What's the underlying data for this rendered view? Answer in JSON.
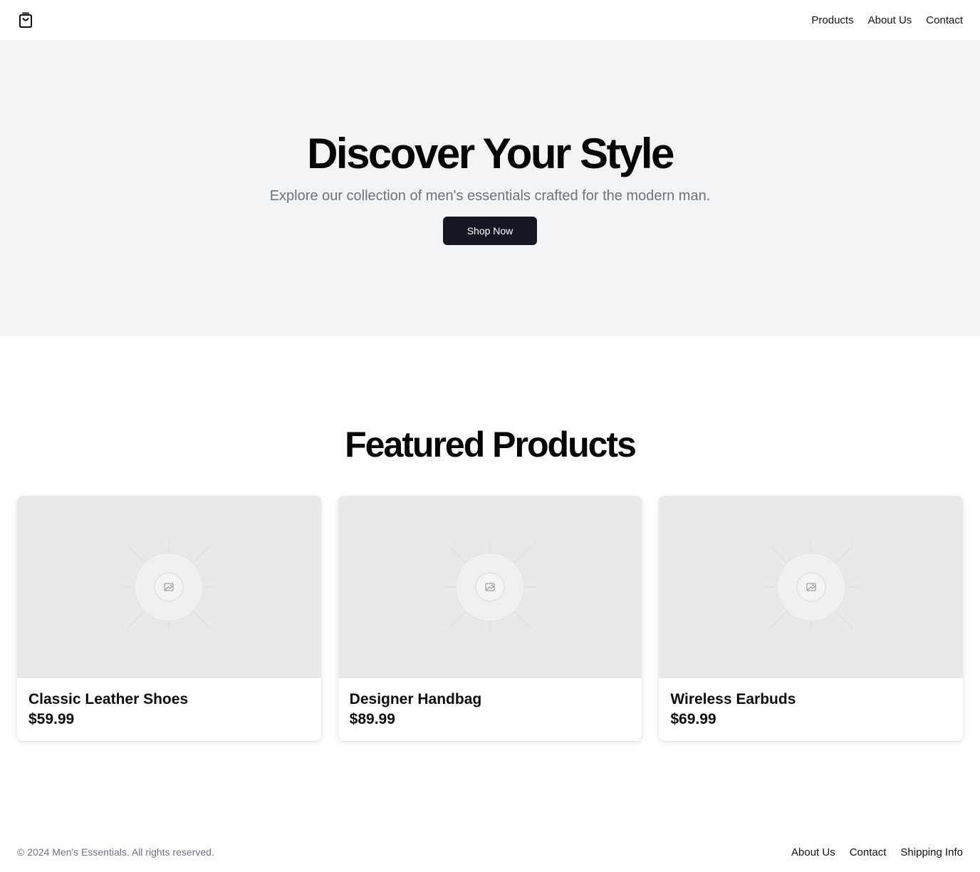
{
  "header": {
    "logo_icon": "shopping-bag-icon",
    "nav": [
      {
        "label": "Products"
      },
      {
        "label": "About Us"
      },
      {
        "label": "Contact"
      }
    ]
  },
  "hero": {
    "title": "Discover Your Style",
    "subtitle": "Explore our collection of men's essentials crafted for the modern man.",
    "cta_label": "Shop Now"
  },
  "featured": {
    "title": "Featured Products",
    "products": [
      {
        "name": "Classic Leather Shoes",
        "price": "$59.99",
        "image_icon": "image-placeholder-icon"
      },
      {
        "name": "Designer Handbag",
        "price": "$89.99",
        "image_icon": "image-placeholder-icon"
      },
      {
        "name": "Wireless Earbuds",
        "price": "$69.99",
        "image_icon": "image-placeholder-icon"
      }
    ]
  },
  "footer": {
    "copyright": "© 2024 Men's Essentials. All rights reserved.",
    "nav": [
      {
        "label": "About Us"
      },
      {
        "label": "Contact"
      },
      {
        "label": "Shipping Info"
      }
    ]
  },
  "colors": {
    "hero_bg": "#f2f4f5",
    "button_bg": "#141824",
    "muted_text": "#6b7280",
    "image_placeholder_bg": "#e9e9e9"
  }
}
